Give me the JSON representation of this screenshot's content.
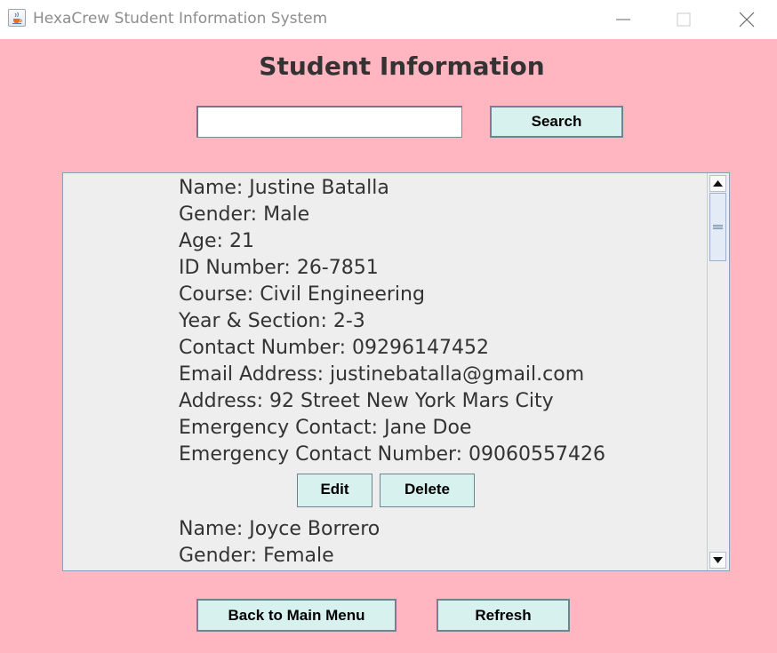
{
  "window": {
    "title": "HexaCrew Student Information System",
    "icon": "java-cup-icon",
    "controls": [
      "minimize-icon",
      "maximize-icon",
      "close-icon"
    ]
  },
  "heading": "Student Information",
  "search": {
    "value": "",
    "button_label": "Search"
  },
  "students": [
    {
      "lines": [
        "Name: Justine Batalla",
        "Gender: Male",
        "Age: 21",
        "ID Number: 26-7851",
        "Course: Civil Engineering",
        "Year & Section: 2-3",
        "Contact Number: 09296147452",
        "Email Address: justinebatalla@gmail.com",
        "Address: 92 Street New York Mars City",
        "Emergency Contact: Jane Doe",
        "Emergency Contact Number: 09060557426"
      ],
      "edit_label": "Edit",
      "delete_label": "Delete"
    },
    {
      "lines": [
        "Name: Joyce Borrero",
        "Gender: Female"
      ]
    }
  ],
  "footer": {
    "back_label": "Back to Main Menu",
    "refresh_label": "Refresh"
  },
  "colors": {
    "background": "#ffb6c1",
    "button": "#d7f1ee",
    "list_background": "#eeeeee",
    "text": "#333333"
  }
}
